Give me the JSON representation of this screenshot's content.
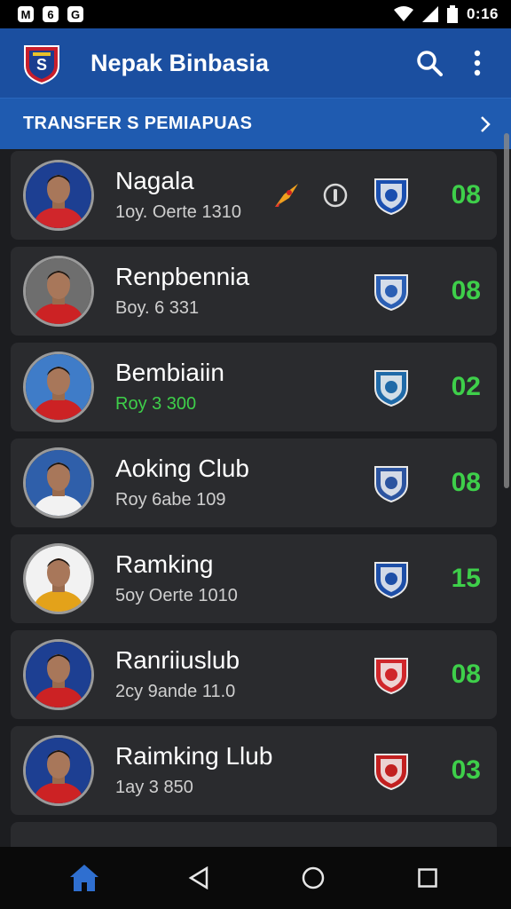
{
  "status_bar": {
    "left_icons": [
      "M",
      "6",
      "G"
    ],
    "time": "0:16"
  },
  "app_bar": {
    "title": "Nepak Binbasia",
    "icons": [
      "club-logo",
      "search-icon",
      "more-vert-icon"
    ]
  },
  "section": {
    "title": "TRANSFER S PEMIAPUAS"
  },
  "players": [
    {
      "name": "Nagala",
      "sub": "1oy. Oerte 1310",
      "score": "08",
      "sub_green": false,
      "has_extras": true,
      "avatar_bg": "#1d3f92",
      "jersey": "#d0262b",
      "badge_color": "#1a4fb0"
    },
    {
      "name": "Renpbennia",
      "sub": "Boy. 6 331",
      "score": "08",
      "sub_green": false,
      "has_extras": false,
      "avatar_bg": "#6e6e6e",
      "jersey": "#cc2224",
      "badge_color": "#2b5fb4"
    },
    {
      "name": "Bembiaiin",
      "sub": "Roy 3 300",
      "score": "02",
      "sub_green": true,
      "has_extras": false,
      "avatar_bg": "#3f7cc8",
      "jersey": "#cc2224",
      "badge_color": "#1f6aa8"
    },
    {
      "name": "Aoking Club",
      "sub": "Roy 6abe 109",
      "score": "08",
      "sub_green": false,
      "has_extras": false,
      "avatar_bg": "#2f5faa",
      "jersey": "#f2f2f2",
      "badge_color": "#2c54a0"
    },
    {
      "name": "Ramking",
      "sub": "5oy Oerte 1010",
      "score": "15",
      "sub_green": false,
      "has_extras": false,
      "avatar_bg": "#f2f2f2",
      "jersey": "#e3a21a",
      "badge_color": "#1d4ea7"
    },
    {
      "name": "Ranriiuslub",
      "sub": "2cy 9ande 11.0",
      "score": "08",
      "sub_green": false,
      "has_extras": false,
      "avatar_bg": "#1d3f92",
      "jersey": "#cc2224",
      "badge_color": "#d0262b"
    },
    {
      "name": "Raimking Llub",
      "sub": "1ay 3 850",
      "score": "03",
      "sub_green": false,
      "has_extras": false,
      "avatar_bg": "#1d3f92",
      "jersey": "#cc2224",
      "badge_color": "#c22020"
    }
  ],
  "nav": {
    "items": [
      "home-icon",
      "back-icon",
      "circle-home-icon",
      "recents-icon"
    ]
  }
}
